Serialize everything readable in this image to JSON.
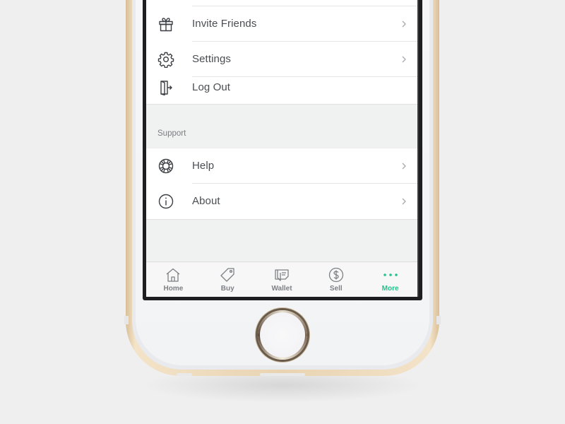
{
  "account_menu": {
    "items": [
      {
        "label": "Invite Friends",
        "icon": "gift-icon",
        "chevron": true
      },
      {
        "label": "Settings",
        "icon": "gear-icon",
        "chevron": true
      },
      {
        "label": "Log Out",
        "icon": "logout-door-icon",
        "chevron": false
      }
    ]
  },
  "support_section": {
    "header": "Support",
    "items": [
      {
        "label": "Help",
        "icon": "lifebuoy-icon",
        "chevron": true
      },
      {
        "label": "About",
        "icon": "info-icon",
        "chevron": true
      }
    ]
  },
  "tabbar": {
    "tabs": [
      {
        "label": "Home",
        "icon": "home-icon",
        "active": false
      },
      {
        "label": "Buy",
        "icon": "price-tag-icon",
        "active": false
      },
      {
        "label": "Wallet",
        "icon": "wallet-icon",
        "active": false
      },
      {
        "label": "Sell",
        "icon": "dollar-circle-icon",
        "active": false
      },
      {
        "label": "More",
        "icon": "more-dots-icon",
        "active": true
      }
    ]
  },
  "colors": {
    "accent": "#21c38c",
    "text": "#4a4d52",
    "tab_inactive": "#7d8084",
    "background": "#f0f1f1",
    "phone_gold": "#e9d3b2"
  }
}
